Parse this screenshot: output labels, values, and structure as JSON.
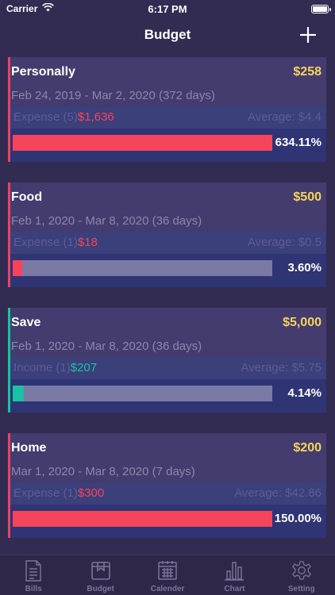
{
  "status": {
    "carrier": "Carrier",
    "time": "6:17 PM"
  },
  "nav": {
    "title": "Budget"
  },
  "budgets": [
    {
      "name": "Personally",
      "amount": "$258",
      "dates": "Feb 24, 2019 - Mar 2, 2020 (372 days)",
      "type_label": "Expense (5)",
      "value": "$1,636",
      "average": "Average: $4.4",
      "percent": "634.11%",
      "progress": 1.0,
      "accent": "#e2456a",
      "fill": "#f6445a",
      "value_color": "#f6445a"
    },
    {
      "name": "Food",
      "amount": "$500",
      "dates": "Feb 1, 2020 - Mar 8, 2020 (36 days)",
      "type_label": "Expense (1)",
      "value": "$18",
      "average": "Average: $0.5",
      "percent": "3.60%",
      "progress": 0.036,
      "accent": "#e2456a",
      "fill": "#f6445a",
      "value_color": "#f6445a"
    },
    {
      "name": "Save",
      "amount": "$5,000",
      "dates": "Feb 1, 2020 - Mar 8, 2020 (36 days)",
      "type_label": "Income (1)",
      "value": "$207",
      "average": "Average: $5.75",
      "percent": "4.14%",
      "progress": 0.0414,
      "accent": "#19c2a0",
      "fill": "#19c2a0",
      "value_color": "#19c2a0"
    },
    {
      "name": "Home",
      "amount": "$200",
      "dates": "Mar 1, 2020 - Mar 8, 2020 (7 days)",
      "type_label": "Expense (1)",
      "value": "$300",
      "average": "Average: $42.86",
      "percent": "150.00%",
      "progress": 1.0,
      "accent": "#e2456a",
      "fill": "#f6445a",
      "value_color": "#f6445a"
    }
  ],
  "tabs": [
    {
      "label": "Bills",
      "icon": "bills-icon",
      "active": false
    },
    {
      "label": "Budget",
      "icon": "budget-icon",
      "active": true
    },
    {
      "label": "Calender",
      "icon": "calendar-icon",
      "active": false
    },
    {
      "label": "Chart",
      "icon": "chart-icon",
      "active": false
    },
    {
      "label": "Setting",
      "icon": "gear-icon",
      "active": false
    }
  ]
}
